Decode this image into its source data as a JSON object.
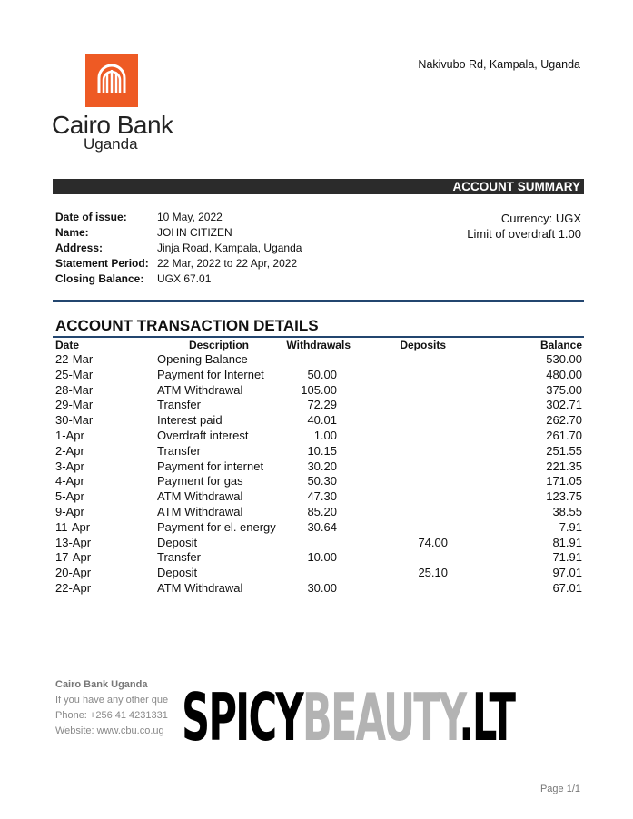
{
  "bank": {
    "name": "Cairo Bank",
    "country": "Uganda",
    "address": "Nakivubo Rd, Kampala, Uganda",
    "brand_color": "#ee5a24"
  },
  "summary_title": "ACCOUNT SUMMARY",
  "account": {
    "date_label": "Date of issue:",
    "date_value": "10 May, 2022",
    "name_label": "Name:",
    "name_value": "JOHN CITIZEN",
    "address_label": "Address:",
    "address_value": "Jinja Road, Kampala, Uganda",
    "period_label": "Statement Period:",
    "period_value": "22 Mar, 2022 to 22 Apr, 2022",
    "closing_label": "Closing Balance:",
    "closing_value": "UGX 67.01"
  },
  "currency_line": "Currency: UGX",
  "overdraft_line": "Limit of overdraft 1.00",
  "transactions_title": "ACCOUNT TRANSACTION DETAILS",
  "columns": [
    "Date",
    "Description",
    "Withdrawals",
    "Deposits",
    "Balance"
  ],
  "transactions": [
    {
      "date": "22-Mar",
      "desc": "Opening Balance",
      "wd": "",
      "dep": "",
      "bal": "530.00"
    },
    {
      "date": "25-Mar",
      "desc": "Payment for Internet",
      "wd": "50.00",
      "dep": "",
      "bal": "480.00"
    },
    {
      "date": "28-Mar",
      "desc": "ATM Withdrawal",
      "wd": "105.00",
      "dep": "",
      "bal": "375.00"
    },
    {
      "date": "29-Mar",
      "desc": "Transfer",
      "wd": "72.29",
      "dep": "",
      "bal": "302.71"
    },
    {
      "date": "30-Mar",
      "desc": "Interest paid",
      "wd": "40.01",
      "dep": "",
      "bal": "262.70"
    },
    {
      "date": "1-Apr",
      "desc": "Overdraft interest",
      "wd": "1.00",
      "dep": "",
      "bal": "261.70"
    },
    {
      "date": "2-Apr",
      "desc": "Transfer",
      "wd": "10.15",
      "dep": "",
      "bal": "251.55"
    },
    {
      "date": "3-Apr",
      "desc": "Payment for internet",
      "wd": "30.20",
      "dep": "",
      "bal": "221.35"
    },
    {
      "date": "4-Apr",
      "desc": "Payment for gas",
      "wd": "50.30",
      "dep": "",
      "bal": "171.05"
    },
    {
      "date": "5-Apr",
      "desc": "ATM Withdrawal",
      "wd": "47.30",
      "dep": "",
      "bal": "123.75"
    },
    {
      "date": "9-Apr",
      "desc": "ATM Withdrawal",
      "wd": "85.20",
      "dep": "",
      "bal": "38.55"
    },
    {
      "date": "11-Apr",
      "desc": "Payment for el. energy",
      "wd": "30.64",
      "dep": "",
      "bal": "7.91"
    },
    {
      "date": "13-Apr",
      "desc": "Deposit",
      "wd": "",
      "dep": "74.00",
      "bal": "81.91"
    },
    {
      "date": "17-Apr",
      "desc": "Transfer",
      "wd": "10.00",
      "dep": "",
      "bal": "71.91"
    },
    {
      "date": "20-Apr",
      "desc": "Deposit",
      "wd": "",
      "dep": "25.10",
      "bal": "97.01"
    },
    {
      "date": "22-Apr",
      "desc": "ATM Withdrawal",
      "wd": "30.00",
      "dep": "",
      "bal": "67.01"
    }
  ],
  "footer": {
    "bank": "Cairo Bank Uganda",
    "line1": "If you have any other que",
    "line2": "Phone: +256 41 4231331",
    "line3": "Website: www.cbu.co.ug"
  },
  "watermark": {
    "part1": "SPICY",
    "part2": "BEAUTY",
    "part3": ".LT"
  },
  "page_number": "Page 1/1"
}
